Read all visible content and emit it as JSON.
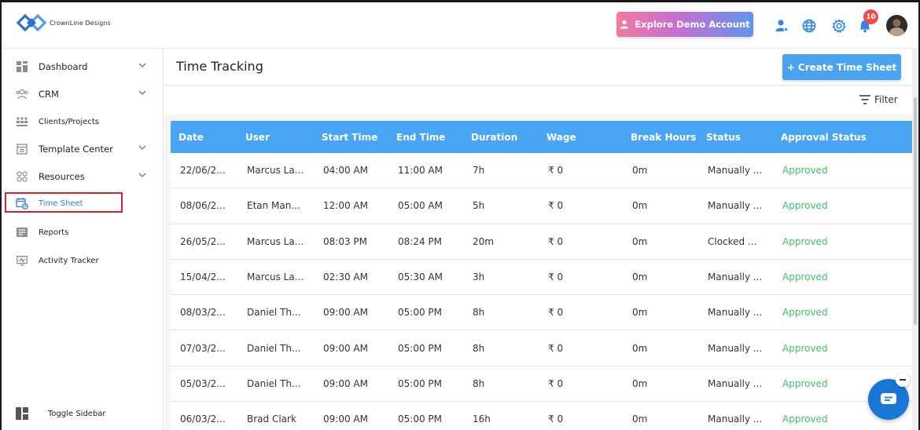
{
  "brand": {
    "name": "CrownLine Designs",
    "accent": "#48a5f3"
  },
  "header": {
    "demo_button": "Explore Demo Account",
    "notification_count": "10",
    "icons": [
      "user-add-icon",
      "globe-icon",
      "gear-icon",
      "bell-icon"
    ]
  },
  "sidebar": {
    "items": [
      {
        "label": "Dashboard",
        "icon": "dashboard-icon",
        "expandable": true
      },
      {
        "label": "CRM",
        "icon": "crm-icon",
        "expandable": true
      },
      {
        "label": "Clients/Projects",
        "icon": "clients-icon",
        "expandable": false
      },
      {
        "label": "Template Center",
        "icon": "template-icon",
        "expandable": true
      },
      {
        "label": "Resources",
        "icon": "resources-icon",
        "expandable": true
      },
      {
        "label": "Time Sheet",
        "icon": "calendar-clock-icon",
        "expandable": false,
        "active": true
      },
      {
        "label": "Reports",
        "icon": "reports-icon",
        "expandable": false
      },
      {
        "label": "Activity Tracker",
        "icon": "activity-icon",
        "expandable": false
      }
    ],
    "toggle_label": "Toggle Sidebar"
  },
  "main": {
    "title": "Time Tracking",
    "create_button": "+ Create Time Sheet",
    "filter_label": "Filter",
    "columns": [
      "Date",
      "User",
      "Start Time",
      "End Time",
      "Duration",
      "Wage",
      "Break Hours",
      "Status",
      "Approval Status"
    ],
    "rows": [
      [
        "22/06/2...",
        "Marcus La...",
        "04:00 AM",
        "11:00 AM",
        "7h",
        "₹ 0",
        "0m",
        "Manually ...",
        "Approved"
      ],
      [
        "08/06/2...",
        "Etan Man...",
        "12:00 AM",
        "05:00 AM",
        "5h",
        "₹ 0",
        "0m",
        "Manually ...",
        "Approved"
      ],
      [
        "26/05/2...",
        "Marcus La...",
        "08:03 PM",
        "08:24 PM",
        "20m",
        "₹ 0",
        "0m",
        "Clocked ...",
        "Approved"
      ],
      [
        "15/04/2...",
        "Marcus La...",
        "02:30 AM",
        "05:30 AM",
        "3h",
        "₹ 0",
        "0m",
        "Manually ...",
        "Approved"
      ],
      [
        "08/03/2...",
        "Daniel Th...",
        "09:00 AM",
        "05:00 PM",
        "8h",
        "₹ 0",
        "0m",
        "Manually ...",
        "Approved"
      ],
      [
        "07/03/2...",
        "Daniel Th...",
        "09:00 AM",
        "05:00 PM",
        "8h",
        "₹ 0",
        "0m",
        "Manually ...",
        "Approved"
      ],
      [
        "05/03/2...",
        "Daniel Th...",
        "09:00 AM",
        "05:00 PM",
        "8h",
        "₹ 0",
        "0m",
        "Manually ...",
        "Approved"
      ],
      [
        "06/03/2...",
        "Brad Clark",
        "09:00 AM",
        "05:00 PM",
        "16h",
        "₹ 0",
        "0m",
        "Manually ...",
        "Approved"
      ]
    ]
  }
}
